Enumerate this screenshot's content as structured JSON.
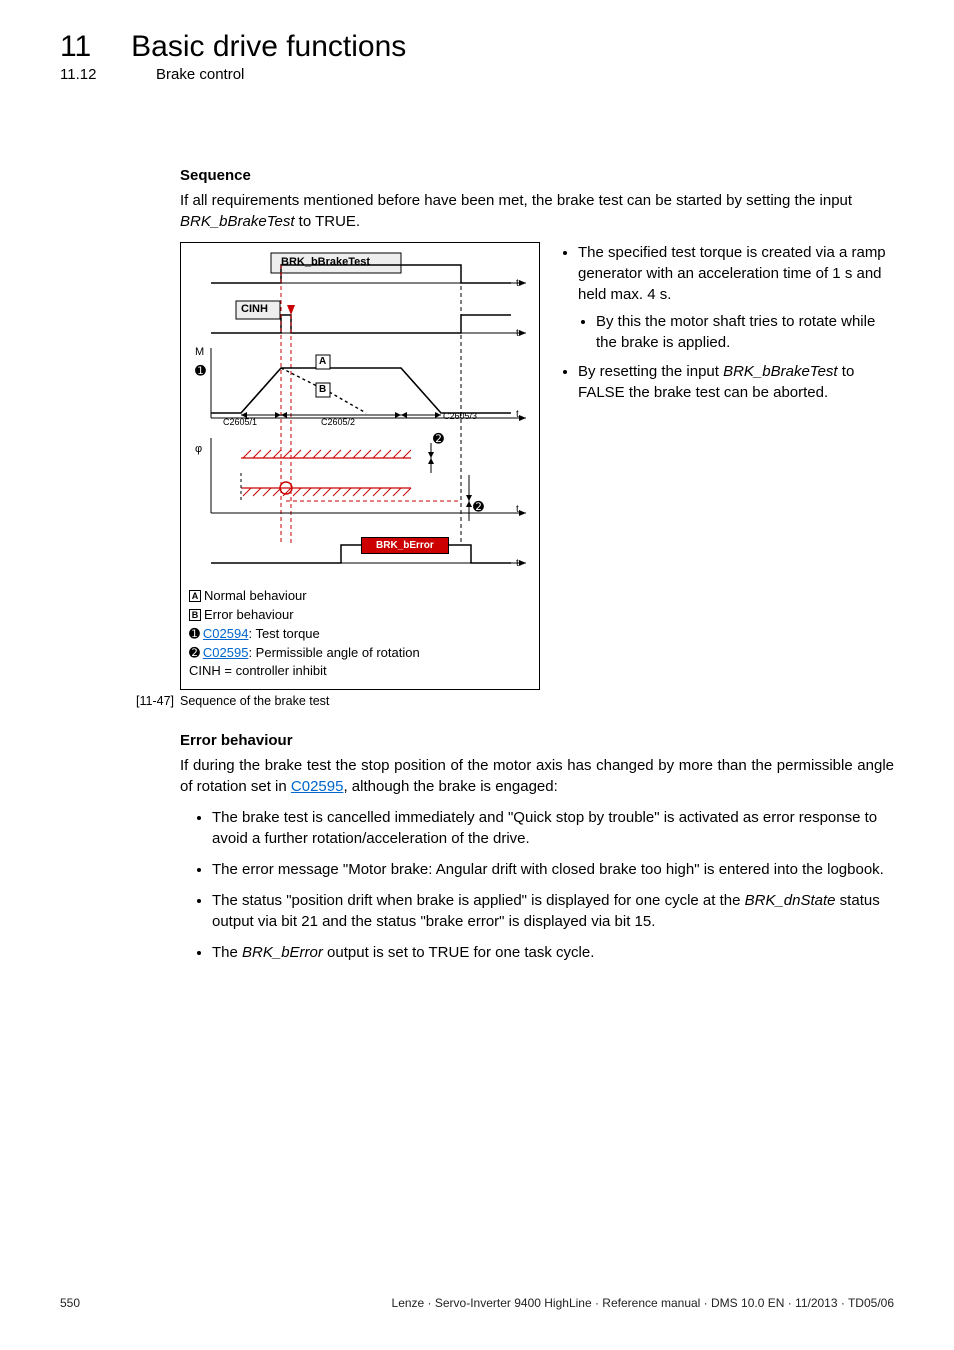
{
  "header": {
    "chapter_num": "11",
    "chapter_title": "Basic drive functions",
    "section_num": "11.12",
    "section_title": "Brake control"
  },
  "dashline": "_ _ _ _ _ _ _ _ _ _ _ _ _ _ _ _ _ _ _ _ _ _ _ _ _ _ _ _ _ _ _ _ _ _ _ _ _ _ _ _ _ _ _ _ _ _ _ _ _ _ _ _ _ _ _ _ _ _ _ _ _ _ _ _",
  "seq": {
    "heading": "Sequence",
    "intro_a": "If all requirements mentioned before have been met, the brake test can be started by setting the input ",
    "intro_i": "BRK_bBrakeTest",
    "intro_b": " to TRUE."
  },
  "diagram": {
    "sig_braketest": "BRK_bBrakeTest",
    "sig_cinh": "CINH",
    "axis_M": "M",
    "axis_phi": "φ",
    "axis_t": "t",
    "boxA": "A",
    "boxB": "B",
    "c1": "C2605/1",
    "c2": "C2605/2",
    "c3": "C2605/3",
    "mark1": "➊",
    "mark2a": "➋",
    "mark2b": "➋",
    "sig_berror": "BRK_bError"
  },
  "legend": {
    "a": "Normal behaviour",
    "b": "Error behaviour",
    "l1_link": "C02594",
    "l1_text": ": Test torque",
    "l2_link": "C02595",
    "l2_text": ": Permissible angle of rotation",
    "cinh": "CINH = controller inhibit"
  },
  "caption": {
    "num": "[11-47]",
    "text": "Sequence of the brake test"
  },
  "rightcol": {
    "b1": "The specified test torque is created via a ramp generator with an acceleration time of 1 s and held max. 4 s.",
    "b1_sub": "By this the motor shaft tries to rotate while the brake is applied.",
    "b2_a": "By resetting the input ",
    "b2_i": "BRK_bBrakeTest",
    "b2_b": " to FALSE the brake test can be aborted."
  },
  "err": {
    "heading": "Error behaviour",
    "intro_a": "If during the brake test the stop position of the motor axis has changed by more than the permissible angle of rotation set in ",
    "intro_link": "C02595",
    "intro_b": ", although the brake is engaged:",
    "e1": "The brake test is cancelled immediately and \"Quick stop by trouble\" is activated as error response to avoid a further rotation/acceleration of the drive.",
    "e2": "The error message \"Motor brake: Angular drift with closed brake too high\" is entered into the logbook.",
    "e3_a": "The status \"position drift when brake is applied\" is displayed for one cycle at the ",
    "e3_i": "BRK_dnState",
    "e3_b": " status output via bit 21 and the status \"brake error\" is displayed via bit 15.",
    "e4_a": "The ",
    "e4_i": "BRK_bError",
    "e4_b": " output is set to TRUE for one task cycle."
  },
  "footer": {
    "page": "550",
    "info": "Lenze · Servo-Inverter 9400 HighLine · Reference manual · DMS 10.0 EN · 11/2013 · TD05/06"
  }
}
